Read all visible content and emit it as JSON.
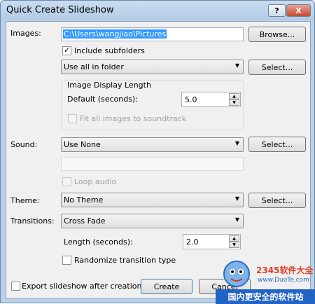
{
  "window": {
    "title": "Quick Create Slideshow",
    "help_label": "?",
    "close_label": "X"
  },
  "images": {
    "label": "Images:",
    "path_value": "C:\\Users\\wangjiao\\Pictures",
    "browse_label": "Browse...",
    "include_subfolders_label": "Include subfolders",
    "include_subfolders_checked": true,
    "mode_value": "Use all in folder",
    "select_label": "Select..."
  },
  "display_length": {
    "group_label": "Image Display Length",
    "default_label": "Default (seconds):",
    "default_value": "5.0",
    "fit_label": "Fit all images to soundtrack",
    "fit_checked": false
  },
  "sound": {
    "label": "Sound:",
    "value": "Use None",
    "select_label": "Select...",
    "loop_label": "Loop audio",
    "loop_checked": false
  },
  "theme": {
    "label": "Theme:",
    "value": "No Theme",
    "select_label": "Select..."
  },
  "transitions": {
    "label": "Transitions:",
    "value": "Cross Fade",
    "length_label": "Length (seconds):",
    "length_value": "2.0",
    "randomize_label": "Randomize transition type",
    "randomize_checked": false
  },
  "footer": {
    "export_label": "Export slideshow after creation",
    "export_checked": false,
    "create_label": "Create",
    "cancel_label": "Cancel"
  },
  "watermark": {
    "brand": "2345软件大全",
    "url": "www.DuoTe.com",
    "banner": "国内更安全的软件站"
  },
  "icons": {
    "checkmark": "checkmark-icon",
    "dropdown": "dropdown-arrow-icon",
    "spin_up": "spin-up-arrow-icon",
    "spin_down": "spin-down-arrow-icon"
  }
}
